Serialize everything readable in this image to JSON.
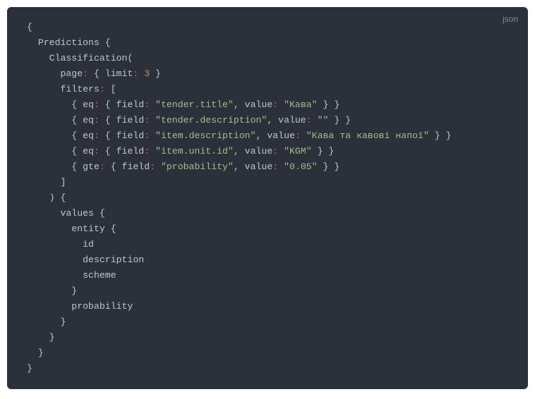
{
  "language_tag": "json",
  "chart_data": {
    "type": "table",
    "title": "GraphQL-style query snippet",
    "query": {
      "Predictions": {
        "Classification": {
          "page": {
            "limit": 3
          },
          "filters": [
            {
              "eq": {
                "field": "tender.title",
                "value": "Кава"
              }
            },
            {
              "eq": {
                "field": "tender.description",
                "value": ""
              }
            },
            {
              "eq": {
                "field": "item.description",
                "value": "Кава та кавові напої"
              }
            },
            {
              "eq": {
                "field": "item.unit.id",
                "value": "KGM"
              }
            },
            {
              "gte": {
                "field": "probability",
                "value": "0.05"
              }
            }
          ],
          "select": {
            "values": {
              "entity": [
                "id",
                "description",
                "scheme"
              ],
              "probability": true
            }
          }
        }
      }
    }
  },
  "tokens": {
    "l1": [
      {
        "t": "{",
        "c": "pl"
      }
    ],
    "l2": [
      {
        "t": "  Predictions {",
        "c": "pl"
      }
    ],
    "l3": [
      {
        "t": "    Classification(",
        "c": "pl"
      }
    ],
    "l4": [
      {
        "t": "      page",
        "c": "pl"
      },
      {
        "t": ":",
        "c": "pc"
      },
      {
        "t": " { limit",
        "c": "pl"
      },
      {
        "t": ":",
        "c": "pc"
      },
      {
        "t": " ",
        "c": "pl"
      },
      {
        "t": "3",
        "c": "num"
      },
      {
        "t": " }",
        "c": "pl"
      }
    ],
    "l5": [
      {
        "t": "      filters",
        "c": "pl"
      },
      {
        "t": ":",
        "c": "pc"
      },
      {
        "t": " [",
        "c": "pl"
      }
    ],
    "l6": [
      {
        "t": "        { eq",
        "c": "pl"
      },
      {
        "t": ":",
        "c": "pc"
      },
      {
        "t": " { field",
        "c": "pl"
      },
      {
        "t": ":",
        "c": "pc"
      },
      {
        "t": " ",
        "c": "pl"
      },
      {
        "t": "\"tender.title\"",
        "c": "str"
      },
      {
        "t": ", value",
        "c": "pl"
      },
      {
        "t": ":",
        "c": "pc"
      },
      {
        "t": " ",
        "c": "pl"
      },
      {
        "t": "\"Кава\"",
        "c": "str"
      },
      {
        "t": " } }",
        "c": "pl"
      }
    ],
    "l7": [
      {
        "t": "        { eq",
        "c": "pl"
      },
      {
        "t": ":",
        "c": "pc"
      },
      {
        "t": " { field",
        "c": "pl"
      },
      {
        "t": ":",
        "c": "pc"
      },
      {
        "t": " ",
        "c": "pl"
      },
      {
        "t": "\"tender.description\"",
        "c": "str"
      },
      {
        "t": ", value",
        "c": "pl"
      },
      {
        "t": ":",
        "c": "pc"
      },
      {
        "t": " ",
        "c": "pl"
      },
      {
        "t": "\"\"",
        "c": "str"
      },
      {
        "t": " } }",
        "c": "pl"
      }
    ],
    "l8": [
      {
        "t": "        { eq",
        "c": "pl"
      },
      {
        "t": ":",
        "c": "pc"
      },
      {
        "t": " { field",
        "c": "pl"
      },
      {
        "t": ":",
        "c": "pc"
      },
      {
        "t": " ",
        "c": "pl"
      },
      {
        "t": "\"item.description\"",
        "c": "str"
      },
      {
        "t": ", value",
        "c": "pl"
      },
      {
        "t": ":",
        "c": "pc"
      },
      {
        "t": " ",
        "c": "pl"
      },
      {
        "t": "\"Кава та кавові напої\"",
        "c": "str"
      },
      {
        "t": " } }",
        "c": "pl"
      }
    ],
    "l9": [
      {
        "t": "        { eq",
        "c": "pl"
      },
      {
        "t": ":",
        "c": "pc"
      },
      {
        "t": " { field",
        "c": "pl"
      },
      {
        "t": ":",
        "c": "pc"
      },
      {
        "t": " ",
        "c": "pl"
      },
      {
        "t": "\"item.unit.id\"",
        "c": "str"
      },
      {
        "t": ", value",
        "c": "pl"
      },
      {
        "t": ":",
        "c": "pc"
      },
      {
        "t": " ",
        "c": "pl"
      },
      {
        "t": "\"KGM\"",
        "c": "str"
      },
      {
        "t": " } }",
        "c": "pl"
      }
    ],
    "l10": [
      {
        "t": "        { gte",
        "c": "pl"
      },
      {
        "t": ":",
        "c": "pc"
      },
      {
        "t": " { field",
        "c": "pl"
      },
      {
        "t": ":",
        "c": "pc"
      },
      {
        "t": " ",
        "c": "pl"
      },
      {
        "t": "\"probability\"",
        "c": "str"
      },
      {
        "t": ", value",
        "c": "pl"
      },
      {
        "t": ":",
        "c": "pc"
      },
      {
        "t": " ",
        "c": "pl"
      },
      {
        "t": "\"0.05\"",
        "c": "str"
      },
      {
        "t": " } }",
        "c": "pl"
      }
    ],
    "l11": [
      {
        "t": "      ]",
        "c": "pl"
      }
    ],
    "l12": [
      {
        "t": "    ) {",
        "c": "pl"
      }
    ],
    "l13": [
      {
        "t": "      values {",
        "c": "pl"
      }
    ],
    "l14": [
      {
        "t": "        entity {",
        "c": "pl"
      }
    ],
    "l15": [
      {
        "t": "          id",
        "c": "pl"
      }
    ],
    "l16": [
      {
        "t": "          description",
        "c": "pl"
      }
    ],
    "l17": [
      {
        "t": "          scheme",
        "c": "pl"
      }
    ],
    "l18": [
      {
        "t": "        }",
        "c": "pl"
      }
    ],
    "l19": [
      {
        "t": "        probability",
        "c": "pl"
      }
    ],
    "l20": [
      {
        "t": "      }",
        "c": "pl"
      }
    ],
    "l21": [
      {
        "t": "    }",
        "c": "pl"
      }
    ],
    "l22": [
      {
        "t": "  }",
        "c": "pl"
      }
    ],
    "l23": [
      {
        "t": "}",
        "c": "pl"
      }
    ]
  }
}
